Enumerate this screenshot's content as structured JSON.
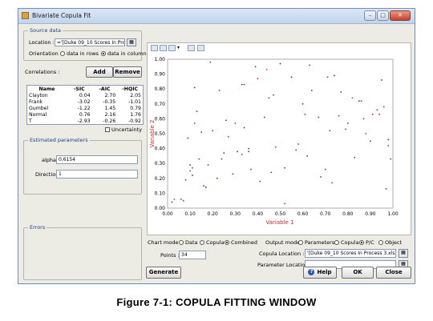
{
  "window": {
    "title": "Bivariate Copula Fit"
  },
  "source": {
    "group_title": "Source data",
    "location_label": "Location :",
    "location_value": "='[Duke 09_10 Scores In Proc",
    "orientation_label": "Orientation :",
    "opt_rows": "data in rows",
    "opt_cols": "data in columns"
  },
  "correlations": {
    "label": "Correlations :",
    "add": "Add",
    "remove": "Remove",
    "headers": [
      "Name",
      "-SIC",
      "-AIC",
      "-HQIC"
    ],
    "rows": [
      [
        "Clayton",
        "0.04",
        "2.70",
        "2.05"
      ],
      [
        "Frank",
        "-3.02",
        "-0.35",
        "-1.01"
      ],
      [
        "Gumbel",
        "-1.22",
        "1.45",
        "0.79"
      ],
      [
        "Normal",
        "0.76",
        "2.16",
        "1.76"
      ],
      [
        "T",
        "-2.93",
        "-0.26",
        "-0.92"
      ]
    ],
    "uncertainty": "Uncertainty"
  },
  "estimated": {
    "group_title": "Estimated parameters",
    "alpha_label": "alpha",
    "alpha_value": "0.6154",
    "direction_label": "Direction",
    "direction_value": "1"
  },
  "errors": {
    "group_title": "Errors"
  },
  "controls": {
    "chart_mode_label": "Chart mode :",
    "chart_data": "Data",
    "chart_copula": "Copula",
    "chart_combined": "Combined",
    "points_label": "Points :",
    "points_value": "34",
    "output_mode_label": "Output mode :",
    "out_parameters": "Parameters",
    "out_copula": "Copula",
    "out_pc": "P/C",
    "out_object": "Object",
    "copula_location_label": "Copula Location :",
    "copula_location_value": "'[Duke 09_10 Scores In Process 3.xlsx]C",
    "parameter_location_label": "Parameter Location :",
    "parameter_location_value": ""
  },
  "buttons": {
    "generate": "Generate",
    "help": "Help",
    "ok": "OK",
    "close": "Close"
  },
  "caption": "Figure 7-1: COPULA FITTING WINDOW",
  "colors": {
    "data_points": "#2a3fb8",
    "copula_points": "#d8222b",
    "axis_label": "#d8222b",
    "group_title": "#1d3f8a"
  },
  "chart_data": {
    "type": "scatter",
    "xlabel": "Variable 1",
    "ylabel": "Variable 2",
    "xlim": [
      0,
      1
    ],
    "ylim": [
      0,
      1
    ],
    "xticks": [
      "0.00",
      "0.10",
      "0.20",
      "0.30",
      "0.40",
      "0.50",
      "0.60",
      "0.70",
      "0.80",
      "0.90",
      "1.00"
    ],
    "yticks": [
      "0.00",
      "0.10",
      "0.20",
      "0.30",
      "0.40",
      "0.50",
      "0.60",
      "0.70",
      "0.80",
      "0.90",
      "1.00"
    ],
    "grid": false,
    "series": [
      {
        "color": "#2a3fb8",
        "points": [
          [
            0.02,
            0.04
          ],
          [
            0.06,
            0.06
          ],
          [
            0.08,
            0.19
          ],
          [
            0.1,
            0.29
          ],
          [
            0.11,
            0.22
          ],
          [
            0.12,
            0.81
          ],
          [
            0.13,
            0.65
          ],
          [
            0.15,
            0.51
          ],
          [
            0.16,
            0.15
          ],
          [
            0.17,
            0.14
          ],
          [
            0.19,
            0.98
          ],
          [
            0.22,
            0.2
          ],
          [
            0.24,
            0.33
          ],
          [
            0.25,
            0.37
          ],
          [
            0.26,
            0.59
          ],
          [
            0.29,
            0.23
          ],
          [
            0.31,
            0.38
          ],
          [
            0.33,
            0.83
          ],
          [
            0.34,
            0.54
          ],
          [
            0.36,
            0.4
          ],
          [
            0.36,
            0.38
          ],
          [
            0.39,
            0.95
          ],
          [
            0.41,
            0.18
          ],
          [
            0.43,
            0.61
          ],
          [
            0.45,
            0.74
          ],
          [
            0.46,
            0.24
          ],
          [
            0.47,
            0.76
          ],
          [
            0.5,
            0.97
          ],
          [
            0.52,
            0.27
          ],
          [
            0.55,
            0.88
          ],
          [
            0.58,
            0.43
          ],
          [
            0.6,
            0.7
          ],
          [
            0.62,
            0.35
          ],
          [
            0.64,
            0.79
          ],
          [
            0.67,
            0.61
          ],
          [
            0.7,
            0.26
          ],
          [
            0.72,
            0.52
          ],
          [
            0.74,
            0.89
          ],
          [
            0.77,
            0.78
          ],
          [
            0.8,
            0.57
          ],
          [
            0.83,
            0.34
          ],
          [
            0.85,
            0.72
          ],
          [
            0.87,
            0.6
          ],
          [
            0.9,
            0.45
          ],
          [
            0.93,
            0.66
          ],
          [
            0.95,
            0.86
          ],
          [
            0.97,
            0.13
          ],
          [
            0.98,
            0.46
          ],
          [
            0.99,
            0.33
          ],
          [
            0.11,
            0.27
          ]
        ]
      },
      {
        "color": "#d8222b",
        "points": [
          [
            0.03,
            0.06
          ],
          [
            0.07,
            0.05
          ],
          [
            0.09,
            0.47
          ],
          [
            0.1,
            0.25
          ],
          [
            0.12,
            0.57
          ],
          [
            0.14,
            0.33
          ],
          [
            0.18,
            0.29
          ],
          [
            0.2,
            0.52
          ],
          [
            0.23,
            0.79
          ],
          [
            0.27,
            0.48
          ],
          [
            0.3,
            0.57
          ],
          [
            0.33,
            0.36
          ],
          [
            0.34,
            0.83
          ],
          [
            0.37,
            0.26
          ],
          [
            0.4,
            0.87
          ],
          [
            0.44,
            0.93
          ],
          [
            0.48,
            0.41
          ],
          [
            0.52,
            0.03
          ],
          [
            0.57,
            0.39
          ],
          [
            0.61,
            0.63
          ],
          [
            0.63,
            0.96
          ],
          [
            0.68,
            0.21
          ],
          [
            0.71,
            0.88
          ],
          [
            0.73,
            0.17
          ],
          [
            0.76,
            0.62
          ],
          [
            0.79,
            0.53
          ],
          [
            0.82,
            0.74
          ],
          [
            0.86,
            0.72
          ],
          [
            0.88,
            0.5
          ],
          [
            0.91,
            0.63
          ],
          [
            0.94,
            0.63
          ],
          [
            0.96,
            0.68
          ],
          [
            0.98,
            0.42
          ]
        ]
      }
    ]
  }
}
